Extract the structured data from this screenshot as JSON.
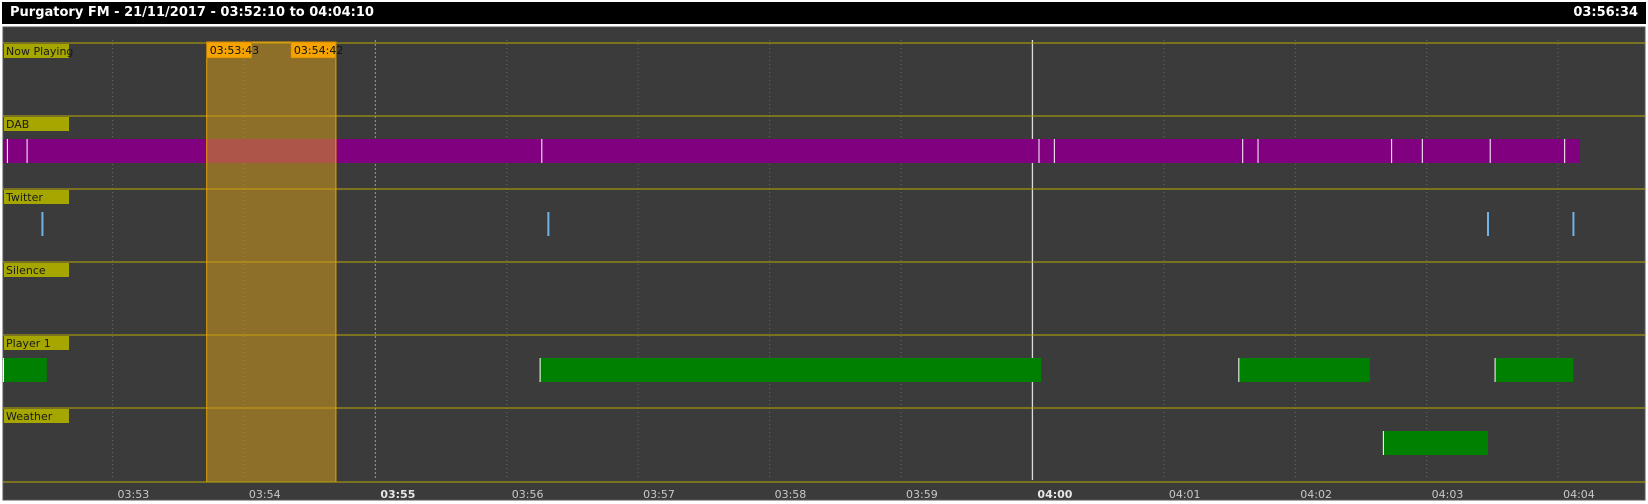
{
  "window": {
    "title": "Purgatory FM - 21/11/2017 - 03:52:10 to 04:04:10",
    "clock": "03:56:34"
  },
  "timeline": {
    "start_time": "03:52:10",
    "end_time": "04:04:10",
    "current_time": "04:00:00",
    "selection": {
      "start": "03:53:43",
      "end": "03:54:42"
    },
    "minor_tick_labels": [
      "03:53",
      "03:54",
      "03:55",
      "03:56",
      "03:57",
      "03:58",
      "03:59",
      "04:00",
      "04:01",
      "04:02",
      "04:03",
      "04:04"
    ],
    "major_ticks": [
      "03:55",
      "04:00"
    ]
  },
  "lanes": [
    {
      "label": "Now Playing",
      "type": "empty"
    },
    {
      "label": "DAB",
      "type": "band",
      "color": "#800080",
      "bars": [
        {
          "start": "03:52:10",
          "end": "04:04:10"
        }
      ],
      "markers": [
        "03:52:12",
        "03:52:21",
        "03:56:16",
        "04:00:03",
        "04:00:10",
        "04:01:36",
        "04:01:43",
        "04:02:44",
        "04:02:58",
        "04:03:29",
        "04:04:03"
      ]
    },
    {
      "label": "Twitter",
      "type": "ticks",
      "color": "#6fb4e8",
      "markers": [
        "03:52:28",
        "03:56:19",
        "04:03:28",
        "04:04:07"
      ]
    },
    {
      "label": "Silence",
      "type": "empty"
    },
    {
      "label": "Player 1",
      "type": "bars",
      "color": "#008000",
      "bars": [
        {
          "start": "03:52:10",
          "end": "03:52:30"
        },
        {
          "start": "03:56:15",
          "end": "04:00:04"
        },
        {
          "start": "04:01:34",
          "end": "04:02:34"
        },
        {
          "start": "04:03:31",
          "end": "04:04:07"
        }
      ]
    },
    {
      "label": "Weather",
      "type": "bars",
      "color": "#008000",
      "bars": [
        {
          "start": "04:02:40",
          "end": "04:03:28"
        }
      ]
    }
  ]
}
